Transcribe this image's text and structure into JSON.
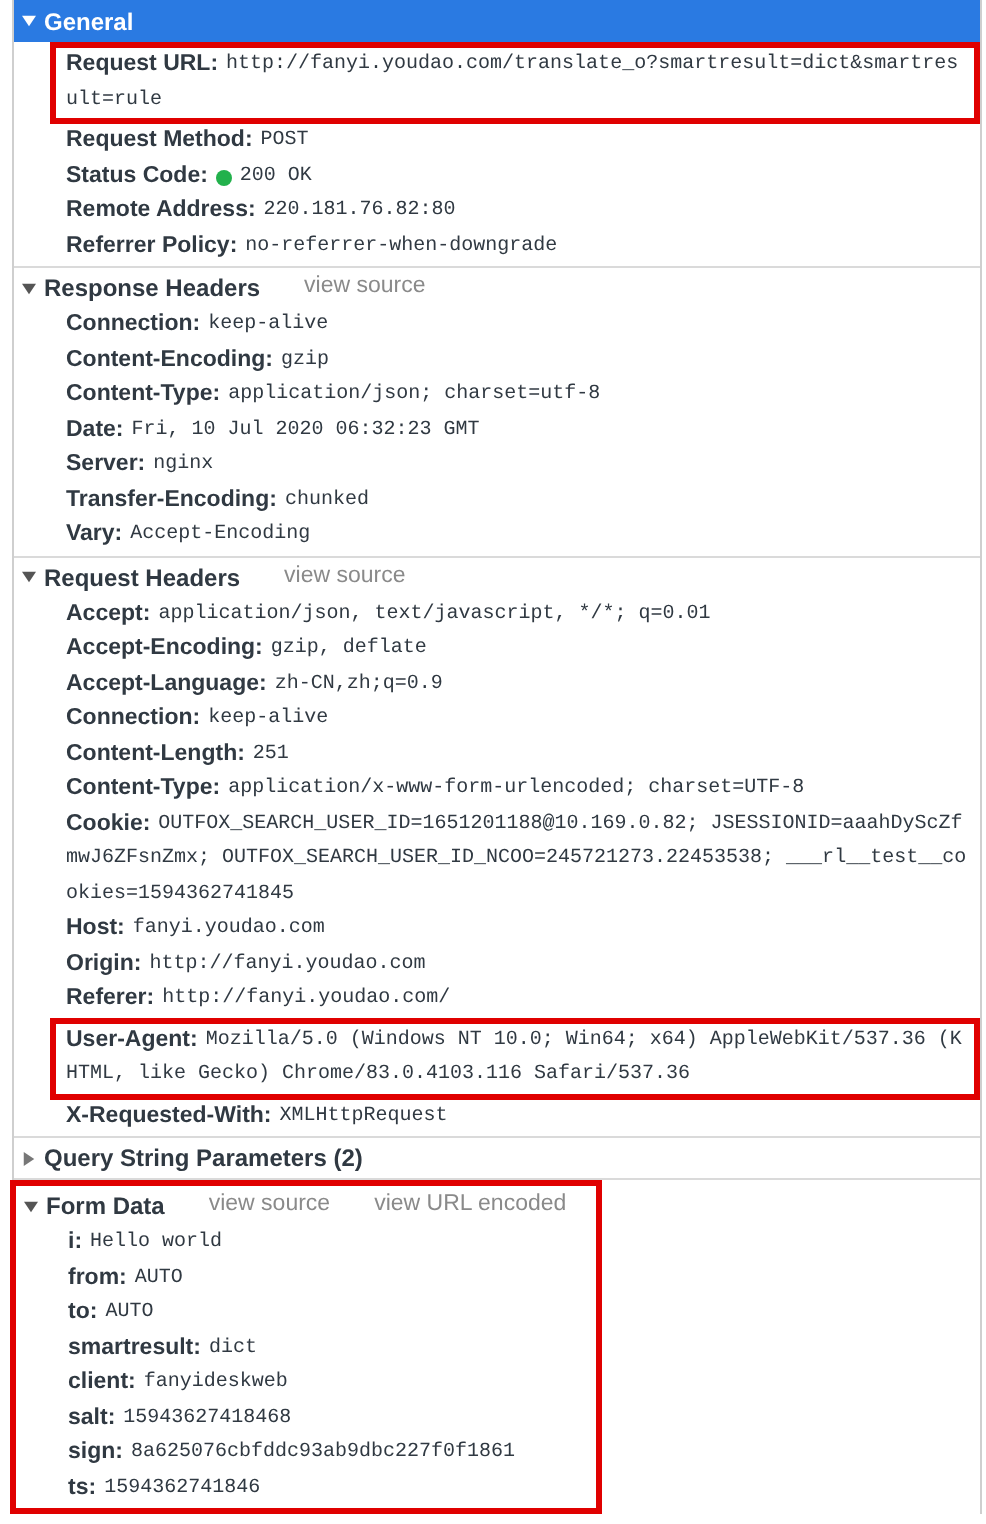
{
  "sections": [
    {
      "title": "General",
      "expanded": true,
      "selected": true,
      "boxed": false,
      "rows": [
        {
          "kind": "plain",
          "key": "Request URL:",
          "value": "http://fanyi.youdao.com/translate_o?smartresult=dict&smartresult=rule",
          "boxed": true
        },
        {
          "kind": "plain",
          "key": "Request Method:",
          "value": "POST",
          "boxed": false
        },
        {
          "kind": "status",
          "key": "Status Code:",
          "value": "200 OK",
          "color": "#22b14c",
          "boxed": false
        },
        {
          "kind": "plain",
          "key": "Remote Address:",
          "value": "220.181.76.82:80",
          "boxed": false
        },
        {
          "kind": "plain",
          "key": "Referrer Policy:",
          "value": "no-referrer-when-downgrade",
          "boxed": false
        }
      ]
    },
    {
      "title": "Response Headers",
      "expanded": true,
      "selected": false,
      "boxed": false,
      "links": [
        "view source"
      ],
      "rows": [
        {
          "kind": "plain",
          "key": "Connection:",
          "value": "keep-alive",
          "boxed": false
        },
        {
          "kind": "plain",
          "key": "Content-Encoding:",
          "value": "gzip",
          "boxed": false
        },
        {
          "kind": "plain",
          "key": "Content-Type:",
          "value": "application/json; charset=utf-8",
          "boxed": false
        },
        {
          "kind": "plain",
          "key": "Date:",
          "value": "Fri, 10 Jul 2020 06:32:23 GMT",
          "boxed": false
        },
        {
          "kind": "plain",
          "key": "Server:",
          "value": "nginx",
          "boxed": false
        },
        {
          "kind": "plain",
          "key": "Transfer-Encoding:",
          "value": "chunked",
          "boxed": false
        },
        {
          "kind": "plain",
          "key": "Vary:",
          "value": "Accept-Encoding",
          "boxed": false
        }
      ]
    },
    {
      "title": "Request Headers",
      "expanded": true,
      "selected": false,
      "boxed": false,
      "links": [
        "view source"
      ],
      "rows": [
        {
          "kind": "plain",
          "key": "Accept:",
          "value": "application/json, text/javascript, */*; q=0.01",
          "boxed": false
        },
        {
          "kind": "plain",
          "key": "Accept-Encoding:",
          "value": "gzip, deflate",
          "boxed": false
        },
        {
          "kind": "plain",
          "key": "Accept-Language:",
          "value": "zh-CN,zh;q=0.9",
          "boxed": false
        },
        {
          "kind": "plain",
          "key": "Connection:",
          "value": "keep-alive",
          "boxed": false
        },
        {
          "kind": "plain",
          "key": "Content-Length:",
          "value": "251",
          "boxed": false
        },
        {
          "kind": "plain",
          "key": "Content-Type:",
          "value": "application/x-www-form-urlencoded; charset=UTF-8",
          "boxed": false
        },
        {
          "kind": "plain",
          "key": "Cookie:",
          "value": "OUTFOX_SEARCH_USER_ID=1651201188@10.169.0.82; JSESSIONID=aaahDyScZfmwJ6ZFsnZmx; OUTFOX_SEARCH_USER_ID_NCOO=245721273.22453538; ___rl__test__cookies=1594362741845",
          "boxed": false
        },
        {
          "kind": "plain",
          "key": "Host:",
          "value": "fanyi.youdao.com",
          "boxed": false
        },
        {
          "kind": "plain",
          "key": "Origin:",
          "value": "http://fanyi.youdao.com",
          "boxed": false
        },
        {
          "kind": "plain",
          "key": "Referer:",
          "value": "http://fanyi.youdao.com/",
          "boxed": false
        },
        {
          "kind": "plain",
          "key": "User-Agent:",
          "value": "Mozilla/5.0 (Windows NT 10.0; Win64; x64) AppleWebKit/537.36 (KHTML, like Gecko) Chrome/83.0.4103.116 Safari/537.36",
          "boxed": true
        },
        {
          "kind": "plain",
          "key": "X-Requested-With:",
          "value": "XMLHttpRequest",
          "boxed": false
        }
      ]
    },
    {
      "title": "Query String Parameters (2)",
      "expanded": false,
      "selected": false,
      "boxed": false
    },
    {
      "title": "Form Data",
      "expanded": true,
      "selected": false,
      "boxed": true,
      "links": [
        "view source",
        "view URL encoded"
      ],
      "rows": [
        {
          "kind": "plain",
          "key": "i:",
          "value": "Hello world",
          "boxed": false
        },
        {
          "kind": "plain",
          "key": "from:",
          "value": "AUTO",
          "boxed": false
        },
        {
          "kind": "plain",
          "key": "to:",
          "value": "AUTO",
          "boxed": false
        },
        {
          "kind": "plain",
          "key": "smartresult:",
          "value": "dict",
          "boxed": false
        },
        {
          "kind": "plain",
          "key": "client:",
          "value": "fanyideskweb",
          "boxed": false
        },
        {
          "kind": "plain",
          "key": "salt:",
          "value": "15943627418468",
          "boxed": false
        },
        {
          "kind": "plain",
          "key": "sign:",
          "value": "8a625076cbfddc93ab9dbc227f0f1861",
          "boxed": false
        },
        {
          "kind": "plain",
          "key": "ts:",
          "value": "1594362741846",
          "boxed": false
        }
      ]
    }
  ]
}
